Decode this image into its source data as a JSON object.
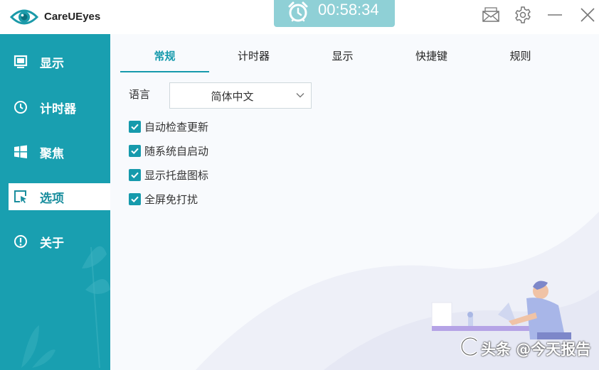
{
  "app": {
    "title": "CareUEyes",
    "timer": "00:58:34"
  },
  "window_buttons": [
    "mail-icon",
    "gear-icon",
    "minimize-icon",
    "close-icon"
  ],
  "sidebar": {
    "items": [
      {
        "label": "显示",
        "icon": "monitor-icon",
        "active": false
      },
      {
        "label": "计时器",
        "icon": "clock-icon",
        "active": false
      },
      {
        "label": "聚焦",
        "icon": "windows-icon",
        "active": false
      },
      {
        "label": "选项",
        "icon": "cursor-select-icon",
        "active": true
      },
      {
        "label": "关于",
        "icon": "info-icon",
        "active": false
      }
    ]
  },
  "tabs": [
    {
      "label": "常规",
      "active": true
    },
    {
      "label": "计时器",
      "active": false
    },
    {
      "label": "显示",
      "active": false
    },
    {
      "label": "快捷键",
      "active": false
    },
    {
      "label": "规则",
      "active": false
    }
  ],
  "general": {
    "language_label": "语言",
    "language_value": "简体中文",
    "checkboxes": [
      {
        "label": "自动检查更新",
        "checked": true
      },
      {
        "label": "随系统自启动",
        "checked": true
      },
      {
        "label": "显示托盘图标",
        "checked": true
      },
      {
        "label": "全屏免打扰",
        "checked": true
      }
    ]
  },
  "watermark": {
    "text": "头条 @今天报告"
  },
  "colors": {
    "sidebar": "#199fb0",
    "accent": "#169aac",
    "timer_bg": "#8fd0d6"
  }
}
